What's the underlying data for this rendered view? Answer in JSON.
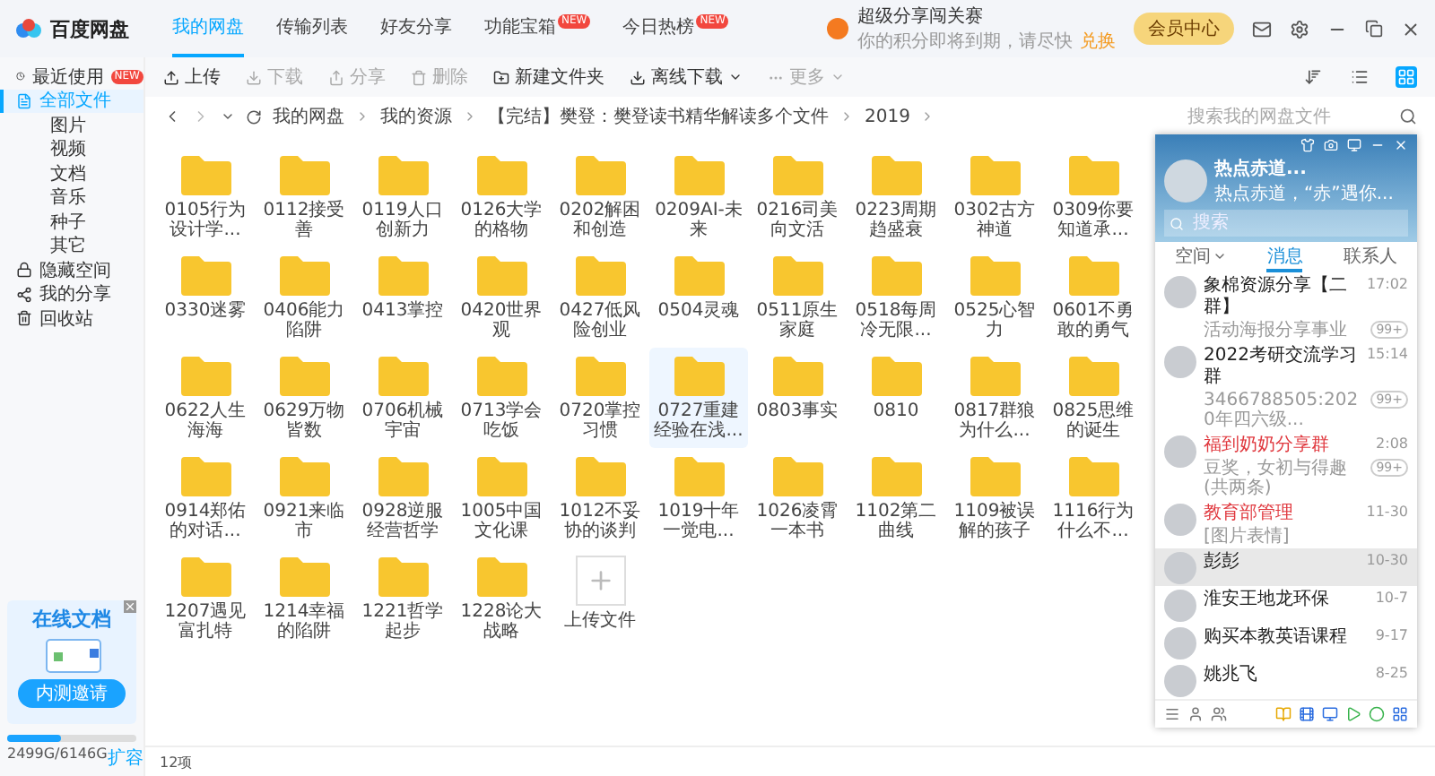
{
  "app": {
    "title": "百度网盘"
  },
  "header": {
    "tabs": [
      {
        "label": "我的网盘",
        "selected": true
      },
      {
        "label": "传输列表",
        "selected": false
      },
      {
        "label": "好友分享",
        "selected": false
      },
      {
        "label": "功能宝箱",
        "selected": false,
        "badge": "NEW"
      },
      {
        "label": "今日热榜",
        "selected": false,
        "badge": "NEW"
      }
    ],
    "promo": {
      "title": "超级分享闯关赛",
      "subtitle": "你的积分即将到期，请尽快",
      "link": "兑换"
    },
    "vip_button": "会员中心"
  },
  "sidebar": {
    "items": [
      {
        "label": "最近使用",
        "badge": "NEW",
        "selected": false
      },
      {
        "label": "全部文件",
        "selected": true,
        "children": [
          {
            "label": "图片",
            "selected": false
          },
          {
            "label": "视频",
            "selected": false
          },
          {
            "label": "文档",
            "selected": false
          },
          {
            "label": "音乐",
            "selected": false
          },
          {
            "label": "种子",
            "selected": false
          },
          {
            "label": "其它",
            "selected": false
          }
        ]
      },
      {
        "label": "隐藏空间",
        "selected": false
      },
      {
        "label": "我的分享",
        "selected": false
      },
      {
        "label": "回收站",
        "selected": false
      }
    ],
    "ad": {
      "title": "在线文档",
      "button": "内测邀请"
    },
    "storage": {
      "level": 0.41,
      "reading": "2499G/6146G",
      "link": "扩容"
    }
  },
  "toolbar": {
    "buttons": [
      {
        "label": "上传",
        "disabled": false,
        "dropdown": false
      },
      {
        "label": "下载",
        "disabled": true,
        "dropdown": false
      },
      {
        "label": "分享",
        "disabled": true,
        "dropdown": false
      },
      {
        "label": "删除",
        "disabled": true,
        "dropdown": false
      },
      {
        "label": "新建文件夹",
        "disabled": false,
        "dropdown": false
      },
      {
        "label": "离线下载",
        "disabled": false,
        "dropdown": true
      },
      {
        "label": "更多",
        "disabled": true,
        "dropdown": true
      }
    ],
    "view_modes": [
      {
        "selected": false
      },
      {
        "selected": false
      },
      {
        "selected": true
      }
    ]
  },
  "path": {
    "crumbs": [
      "我的网盘",
      "我的资源",
      "【完结】樊登：樊登读书精华解读多个文件",
      "2019"
    ],
    "search": {
      "placeholder": "搜索我的网盘文件"
    }
  },
  "files": [
    {
      "kind": "folder",
      "name": "0105行为设计学...",
      "selected": false
    },
    {
      "kind": "folder",
      "name": "0112接受善",
      "selected": false
    },
    {
      "kind": "folder",
      "name": "0119人口创新力",
      "selected": false
    },
    {
      "kind": "folder",
      "name": "0126大学的格物",
      "selected": false
    },
    {
      "kind": "folder",
      "name": "0202解困和创造",
      "selected": false
    },
    {
      "kind": "folder",
      "name": "0209AI-未来",
      "selected": false
    },
    {
      "kind": "folder",
      "name": "0216司美向文活",
      "selected": false
    },
    {
      "kind": "folder",
      "name": "0223周期趋盛衰",
      "selected": false
    },
    {
      "kind": "folder",
      "name": "0302古方神道",
      "selected": false
    },
    {
      "kind": "folder",
      "name": "0309你要知道承...",
      "selected": false
    },
    {
      "kind": "folder",
      "name": "0330迷雾",
      "selected": false
    },
    {
      "kind": "folder",
      "name": "0406能力陷阱",
      "selected": false
    },
    {
      "kind": "folder",
      "name": "0413掌控",
      "selected": false
    },
    {
      "kind": "folder",
      "name": "0420世界观",
      "selected": false
    },
    {
      "kind": "folder",
      "name": "0427低风险创业",
      "selected": false
    },
    {
      "kind": "folder",
      "name": "0504灵魂",
      "selected": false
    },
    {
      "kind": "folder",
      "name": "0511原生家庭",
      "selected": false
    },
    {
      "kind": "folder",
      "name": "0518每周冷无限...",
      "selected": false
    },
    {
      "kind": "folder",
      "name": "0525心智力",
      "selected": false
    },
    {
      "kind": "folder",
      "name": "0601不勇敢的勇气",
      "selected": false
    },
    {
      "kind": "folder",
      "name": "0622人生海海",
      "selected": false
    },
    {
      "kind": "folder",
      "name": "0629万物皆数",
      "selected": false
    },
    {
      "kind": "folder",
      "name": "0706机械宇宙",
      "selected": false
    },
    {
      "kind": "folder",
      "name": "0713学会吃饭",
      "selected": false
    },
    {
      "kind": "folder",
      "name": "0720掌控习惯",
      "selected": false
    },
    {
      "kind": "folder",
      "name": "0727重建经验在浅...",
      "selected": true
    },
    {
      "kind": "folder",
      "name": "0803事实",
      "selected": false
    },
    {
      "kind": "folder",
      "name": "0810",
      "selected": false
    },
    {
      "kind": "folder",
      "name": "0817群狼为什么...",
      "selected": false
    },
    {
      "kind": "folder",
      "name": "0825思维的诞生",
      "selected": false
    },
    {
      "kind": "folder",
      "name": "0914郑佑的对话...",
      "selected": false
    },
    {
      "kind": "folder",
      "name": "0921来临市",
      "selected": false
    },
    {
      "kind": "folder",
      "name": "0928逆服经营哲学",
      "selected": false
    },
    {
      "kind": "folder",
      "name": "1005中国文化课",
      "selected": false
    },
    {
      "kind": "folder",
      "name": "1012不妥协的谈判",
      "selected": false
    },
    {
      "kind": "folder",
      "name": "1019十年一觉电...",
      "selected": false
    },
    {
      "kind": "folder",
      "name": "1026凌霄一本书",
      "selected": false
    },
    {
      "kind": "folder",
      "name": "1102第二曲线",
      "selected": false
    },
    {
      "kind": "folder",
      "name": "1109被误解的孩子",
      "selected": false
    },
    {
      "kind": "folder",
      "name": "1116行为什么不...",
      "selected": false
    },
    {
      "kind": "folder",
      "name": "1207遇见富扎特",
      "selected": false
    },
    {
      "kind": "folder",
      "name": "1214幸福的陷阱",
      "selected": false
    },
    {
      "kind": "folder",
      "name": "1221哲学起步",
      "selected": false
    },
    {
      "kind": "folder",
      "name": "1228论大战略",
      "selected": false
    },
    {
      "kind": "upload",
      "name": "上传文件",
      "selected": false
    }
  ],
  "status_bar": {
    "count": "12项"
  },
  "chat_panel": {
    "profile": {
      "name": "热点赤道...",
      "status": "热点赤道，“赤”遇你..."
    },
    "search": {
      "placeholder": "搜索"
    },
    "tabs": [
      {
        "label": "空间",
        "selected": false,
        "dropdown": true
      },
      {
        "label": "消息",
        "selected": true,
        "dropdown": false
      },
      {
        "label": "联系人",
        "selected": false,
        "dropdown": false
      }
    ],
    "messages": [
      {
        "name": "象棉资源分享【二群】",
        "time": "17:02",
        "preview": "活动海报分享事业",
        "badge": "99+",
        "color": "#222222",
        "selected": false
      },
      {
        "name": "2022考研交流学习群",
        "time": "15:14",
        "preview": "3466788505:2020年四六级...",
        "badge": "99+",
        "color": "#222222",
        "selected": false
      },
      {
        "name": "福到奶奶分享群",
        "time": "2:08",
        "preview": "豆奖，女初与得趣 (共两条)",
        "badge": "99+",
        "color": "#e0383e",
        "selected": false
      },
      {
        "name": "教育部管理",
        "time": "11-30",
        "preview": "[图片表情]",
        "color": "#e0383e",
        "selected": false
      },
      {
        "name": "彭彭",
        "time": "10-30",
        "color": "#222222",
        "selected": true
      },
      {
        "name": "淮安王地龙环保",
        "time": "10-7",
        "color": "#222222",
        "selected": false
      },
      {
        "name": "购买本教英语课程",
        "time": "9-17",
        "color": "#222222",
        "selected": false
      },
      {
        "name": "姚兆飞",
        "time": "8-25",
        "color": "#222222",
        "selected": false
      }
    ]
  }
}
